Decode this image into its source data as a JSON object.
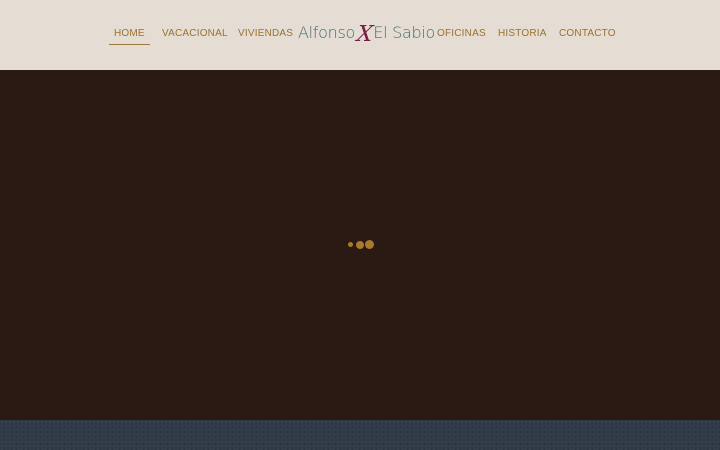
{
  "header": {
    "nav_left": [
      {
        "label": "HOME",
        "active": true
      },
      {
        "label": "VACACIONAL",
        "active": false
      },
      {
        "label": "VIVIENDAS",
        "active": false
      }
    ],
    "logo": {
      "part1": "Alfonso",
      "mark": "X",
      "part2": "El Sabio"
    },
    "nav_right": [
      {
        "label": "OFICINAS",
        "active": false
      },
      {
        "label": "HISTORIA",
        "active": false
      },
      {
        "label": "CONTACTO",
        "active": false
      }
    ]
  },
  "loader": {
    "icon": "loading-dots-icon"
  },
  "colors": {
    "header_bg": "#e5ddd3",
    "nav_text": "#9a7130",
    "logo_text": "#3f6a6f",
    "logo_mark": "#7a1c45",
    "page_bg": "#2b1a13",
    "loader_dot": "#a97a2c",
    "footer_bg": "#2f3a47"
  }
}
